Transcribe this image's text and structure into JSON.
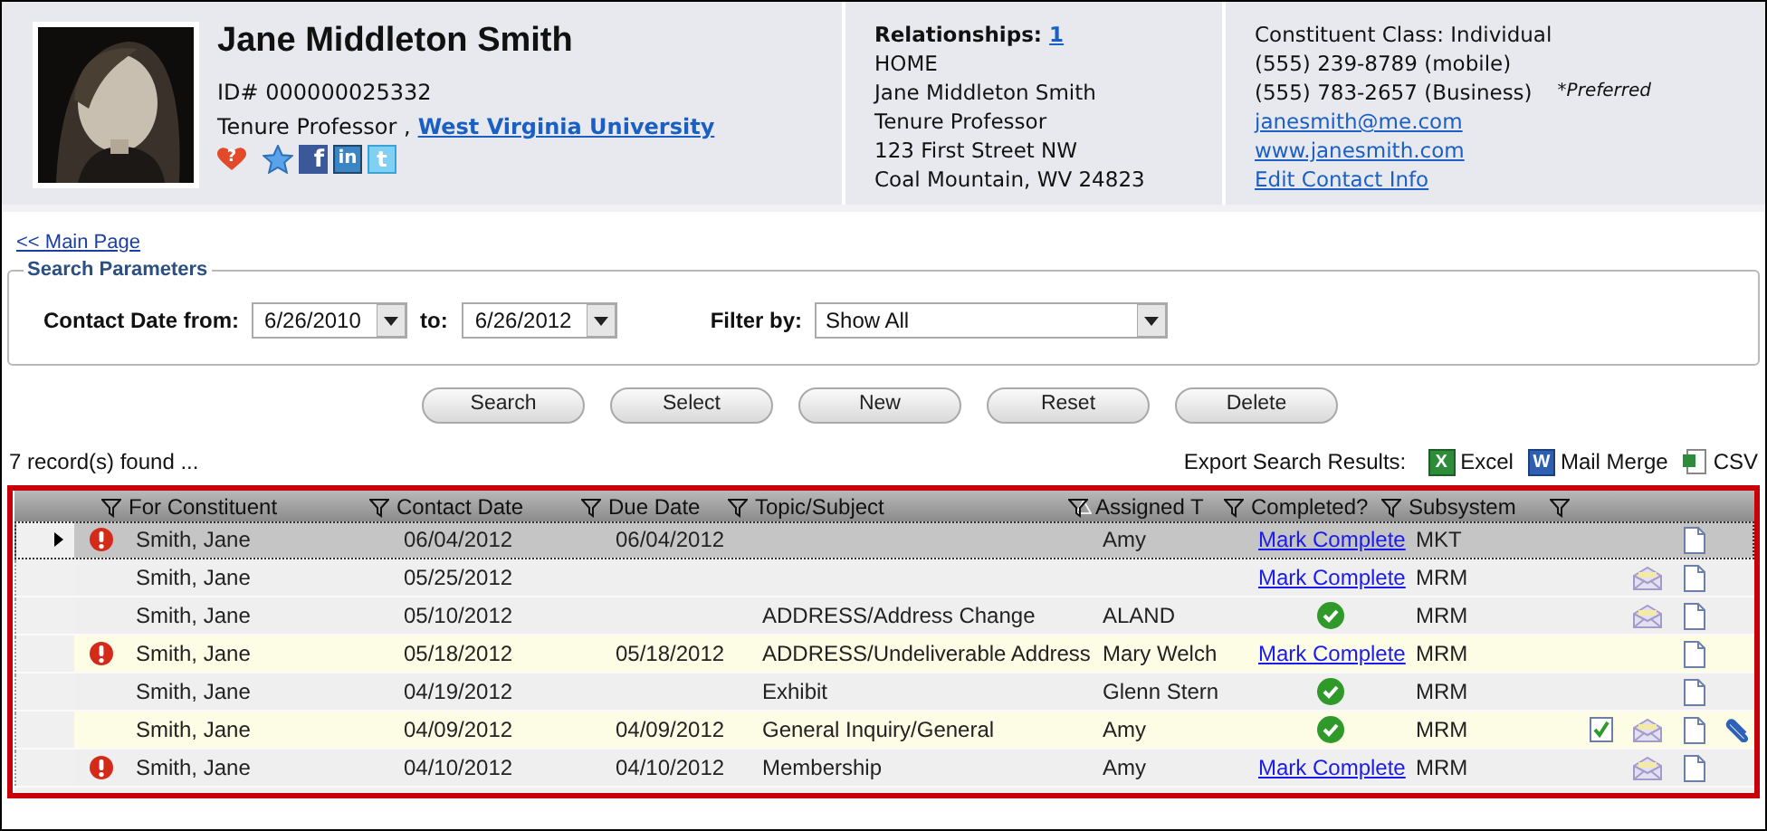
{
  "profile": {
    "name": "Jane Middleton Smith",
    "id": "ID# 000000025332",
    "title": "Tenure Professor ,",
    "organization": "West Virginia University",
    "badges": [
      {
        "kind": "heart",
        "glyph": "?"
      },
      {
        "kind": "star"
      },
      {
        "kind": "facebook",
        "glyph": "f"
      },
      {
        "kind": "linkedin",
        "glyph": "in"
      },
      {
        "kind": "twitter",
        "glyph": "t"
      }
    ]
  },
  "relationships": {
    "label": "Relationships:",
    "count": "1",
    "lines": [
      "HOME",
      "Jane Middleton Smith",
      "Tenure Professor",
      "123 First Street NW",
      "Coal Mountain, WV 24823"
    ]
  },
  "contact": {
    "class": "Constituent Class: Individual",
    "phones": [
      {
        "number": "(555) 239-8789 (mobile)"
      },
      {
        "number": "(555) 783-2657 (Business)",
        "note": "*Preferred"
      }
    ],
    "links": [
      "janesmith@me.com",
      "www.janesmith.com",
      "Edit Contact Info"
    ]
  },
  "back_link": "<< Main Page",
  "search": {
    "legend": "Search Parameters",
    "from_label": "Contact Date from:",
    "from": "6/26/2010",
    "to_label": "to:",
    "to": "6/26/2012",
    "filter_label": "Filter by:",
    "filter": "Show All"
  },
  "buttons": [
    "Search",
    "Select",
    "New",
    "Reset",
    "Delete"
  ],
  "record_count": "7 record(s) found ...",
  "export": {
    "label": "Export Search Results:",
    "items": [
      {
        "kind": "excel",
        "glyph": "X",
        "label": "Excel"
      },
      {
        "kind": "word",
        "glyph": "W",
        "label": "Mail Merge"
      },
      {
        "kind": "csv",
        "label": "CSV"
      }
    ]
  },
  "table": {
    "columns": [
      {
        "label": "For Constituent"
      },
      {
        "label": "Contact Date"
      },
      {
        "label": "Due Date"
      },
      {
        "label": "Topic/Subject",
        "sorted": true
      },
      {
        "label": "Assigned T"
      },
      {
        "label": "Completed?"
      },
      {
        "label": "Subsystem"
      }
    ],
    "rows": [
      {
        "selected": true,
        "highlighted": false,
        "overdue": true,
        "constituent": "Smith, Jane",
        "contact_date": "06/04/2012",
        "due_date": "06/04/2012",
        "topic": "",
        "assigned": "Amy",
        "completed": false,
        "action": "Mark Complete",
        "subsystem": "MKT",
        "task": false,
        "email": false,
        "note": true,
        "attachment": false
      },
      {
        "selected": false,
        "highlighted": false,
        "overdue": false,
        "constituent": "Smith, Jane",
        "contact_date": "05/25/2012",
        "due_date": "",
        "topic": "",
        "assigned": "",
        "completed": false,
        "action": "Mark Complete",
        "subsystem": "MRM",
        "task": false,
        "email": true,
        "note": true,
        "attachment": false
      },
      {
        "selected": false,
        "highlighted": false,
        "overdue": false,
        "constituent": "Smith, Jane",
        "contact_date": "05/10/2012",
        "due_date": "",
        "topic": "ADDRESS/Address Change",
        "assigned": "ALAND",
        "completed": true,
        "subsystem": "MRM",
        "task": false,
        "email": true,
        "note": true,
        "attachment": false
      },
      {
        "selected": false,
        "highlighted": true,
        "overdue": true,
        "constituent": "Smith, Jane",
        "contact_date": "05/18/2012",
        "due_date": "05/18/2012",
        "topic": "ADDRESS/Undeliverable Address",
        "assigned": "Mary Welch",
        "completed": false,
        "action": "Mark Complete",
        "subsystem": "MRM",
        "task": false,
        "email": false,
        "note": true,
        "attachment": false
      },
      {
        "selected": false,
        "highlighted": false,
        "overdue": false,
        "constituent": "Smith, Jane",
        "contact_date": "04/19/2012",
        "due_date": "",
        "topic": "Exhibit",
        "assigned": "Glenn Stern",
        "completed": true,
        "subsystem": "MRM",
        "task": false,
        "email": false,
        "note": true,
        "attachment": false
      },
      {
        "selected": false,
        "highlighted": true,
        "overdue": false,
        "constituent": "Smith, Jane",
        "contact_date": "04/09/2012",
        "due_date": "04/09/2012",
        "topic": "General Inquiry/General",
        "assigned": "Amy",
        "completed": true,
        "subsystem": "MRM",
        "task": true,
        "email": true,
        "note": true,
        "attachment": true
      },
      {
        "selected": false,
        "highlighted": false,
        "overdue": true,
        "constituent": "Smith, Jane",
        "contact_date": "04/10/2012",
        "due_date": "04/10/2012",
        "topic": "Membership",
        "assigned": "Amy",
        "completed": false,
        "action": "Mark Complete",
        "subsystem": "MRM",
        "task": false,
        "email": true,
        "note": true,
        "attachment": false
      }
    ]
  }
}
